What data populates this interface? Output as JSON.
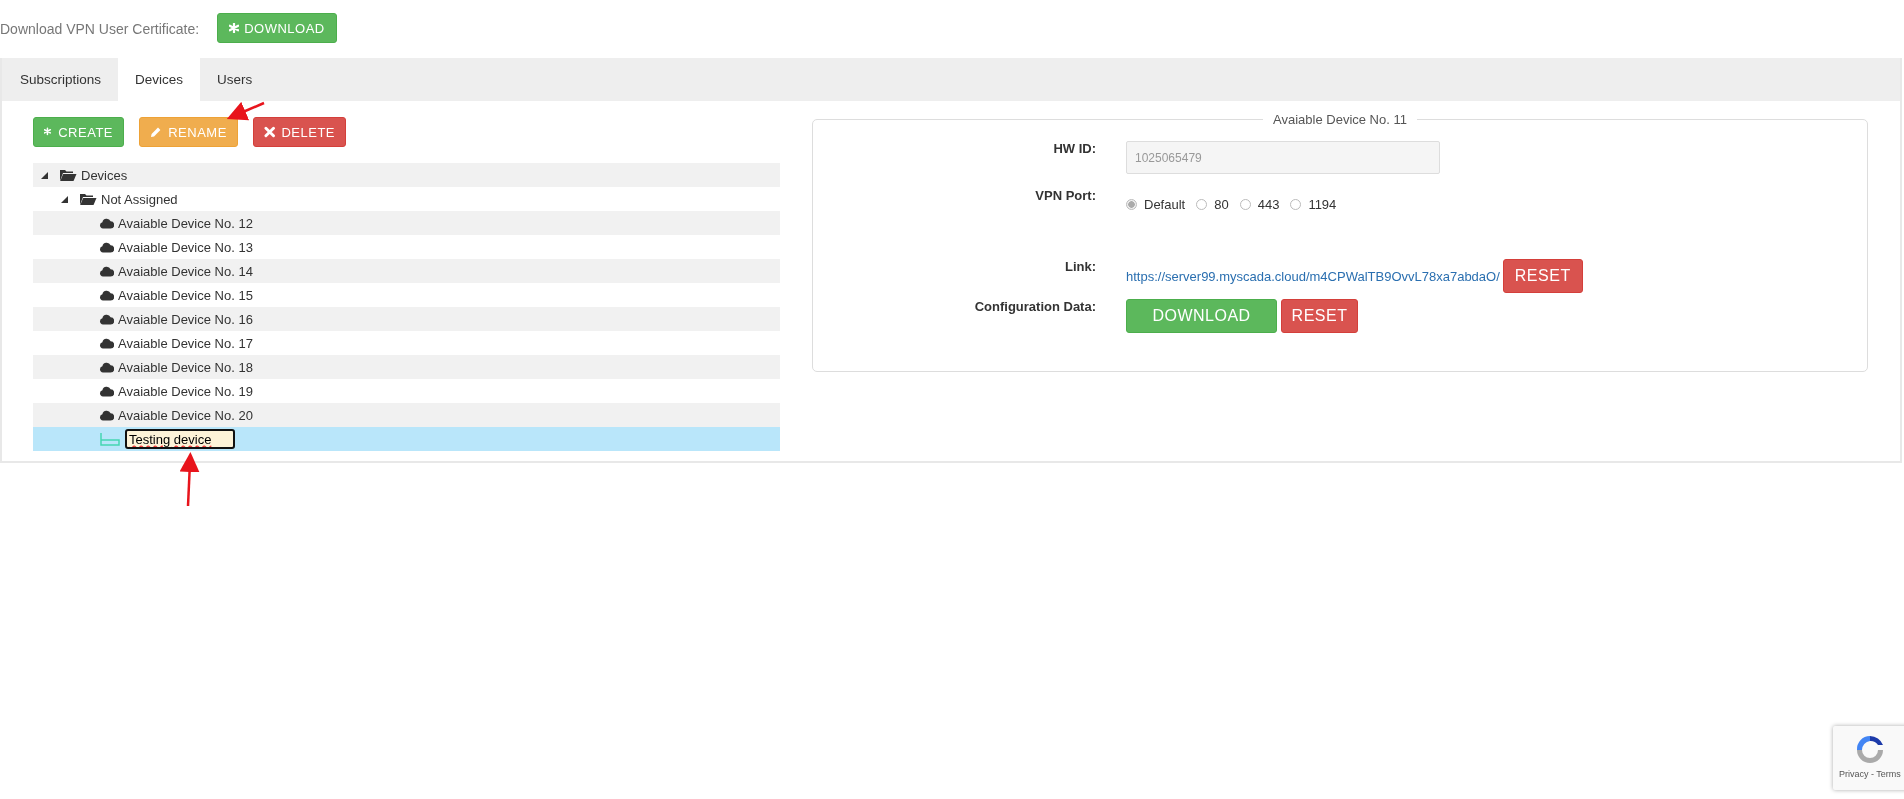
{
  "certificate": {
    "label": "Download VPN User Certificate:",
    "button": "DOWNLOAD"
  },
  "tabs": [
    {
      "label": "Subscriptions",
      "selected": false
    },
    {
      "label": "Devices",
      "selected": true
    },
    {
      "label": "Users",
      "selected": false
    }
  ],
  "toolbar": [
    {
      "label": "CREATE",
      "kind": "create"
    },
    {
      "label": "RENAME",
      "kind": "rename"
    },
    {
      "label": "DELETE",
      "kind": "delete"
    }
  ],
  "tree": [
    {
      "label": "Devices",
      "kind": "folder",
      "expanded": true,
      "selected": false,
      "children": [
        {
          "label": "Not Assigned",
          "kind": "folder",
          "expanded": true,
          "selected": false,
          "children": [
            {
              "label": "Avaiable Device No. 12",
              "kind": "cloud",
              "selected": false
            },
            {
              "label": "Avaiable Device No. 13",
              "kind": "cloud",
              "selected": false
            },
            {
              "label": "Avaiable Device No. 14",
              "kind": "cloud",
              "selected": false
            },
            {
              "label": "Avaiable Device No. 15",
              "kind": "cloud",
              "selected": false
            },
            {
              "label": "Avaiable Device No. 16",
              "kind": "cloud",
              "selected": false
            },
            {
              "label": "Avaiable Device No. 17",
              "kind": "cloud",
              "selected": false
            },
            {
              "label": "Avaiable Device No. 18",
              "kind": "cloud",
              "selected": false
            },
            {
              "label": "Avaiable Device No. 19",
              "kind": "cloud",
              "selected": false
            },
            {
              "label": "Avaiable Device No. 20",
              "kind": "cloud",
              "selected": false
            },
            {
              "label": "Testing device",
              "kind": "router",
              "editing": true,
              "selected": true
            }
          ]
        }
      ]
    }
  ],
  "details": {
    "legend": "Avaiable Device No. 11",
    "hw_id": {
      "label": "HW ID:",
      "value": "1025065479",
      "disabled": true
    },
    "vpn_port": {
      "label": "VPN Port:",
      "options": [
        {
          "label": "Default",
          "selected": true
        },
        {
          "label": "80",
          "selected": false
        },
        {
          "label": "443",
          "selected": false
        },
        {
          "label": "1194",
          "selected": false
        }
      ]
    },
    "link": {
      "label": "Link:",
      "url": "https://server99.myscada.cloud/m4CPWalTB9OvvL78xa7abdaO/",
      "button": "RESET"
    },
    "configuration": {
      "label": "Configuration Data:",
      "buttons": [
        {
          "label": "DOWNLOAD",
          "kind": "success"
        },
        {
          "label": "RESET",
          "kind": "danger"
        }
      ]
    }
  },
  "recaptcha": {
    "text": "Privacy - Terms"
  }
}
